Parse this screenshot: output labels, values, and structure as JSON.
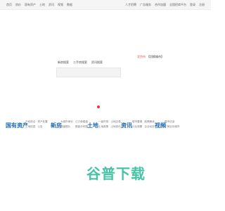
{
  "topbar": {
    "left": [
      "首页",
      "房价",
      "国有资产",
      "土地",
      "资讯",
      "视频",
      "数据"
    ],
    "right": [
      "人才招聘",
      "广告服务",
      "合作加盟",
      "全国招商平台",
      "登录",
      "注册"
    ]
  },
  "city": {
    "name": "北京市",
    "switch_label": "【切换城市】"
  },
  "search": {
    "tabs": [
      "新房搜索",
      "二手房搜索",
      "资讯搜索"
    ],
    "placeholder": ""
  },
  "sections": [
    {
      "title": "国有资产",
      "links": [
        "产权综合",
        "资产处置",
        "土地信息",
        "公告"
      ]
    },
    {
      "title": "新房",
      "links": [
        "大城市房价",
        "订订单楼盘",
        "楼盘图片",
        "楼盘分布图"
      ]
    },
    {
      "title": "土地",
      "links": [
        "一级市场",
        "土地交易",
        "土地政策",
        "土地资讯"
      ]
    },
    {
      "title": "资讯",
      "links": [
        "楼市要闻",
        "政策解读",
        "行业观察",
        "企业动态"
      ]
    },
    {
      "title": "视频",
      "links": [
        "楼市访谈",
        "千房百问城市"
      ]
    }
  ],
  "logo": {
    "text": "谷普下载",
    "color": "#47c3a6"
  },
  "colors": {
    "accent": "#1e6ab3",
    "city": "#e23b3b"
  }
}
